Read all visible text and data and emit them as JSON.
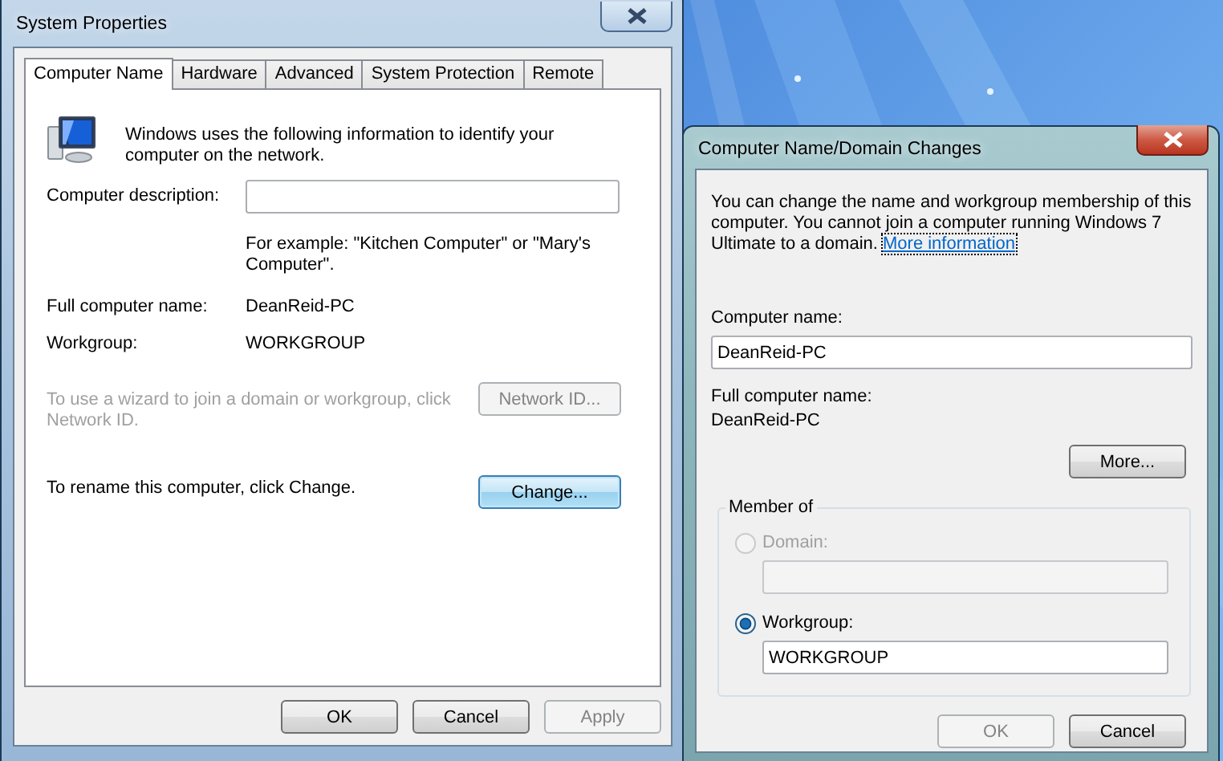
{
  "system_properties": {
    "title": "System Properties",
    "active": false,
    "tabs": [
      {
        "label": "Computer Name",
        "selected": true
      },
      {
        "label": "Hardware",
        "selected": false
      },
      {
        "label": "Advanced",
        "selected": false
      },
      {
        "label": "System Protection",
        "selected": false
      },
      {
        "label": "Remote",
        "selected": false
      }
    ],
    "intro": "Windows uses the following information to identify your computer on the network.",
    "description": {
      "label": "Computer description:",
      "hint": "For example: \"Kitchen Computer\" or \"Mary's Computer\"."
    },
    "info_rows": [
      {
        "label": "Full computer name:",
        "value": "DeanReid-PC"
      },
      {
        "label": "Workgroup:",
        "value": "WORKGROUP"
      }
    ],
    "actions": [
      {
        "text": "To use a wizard to join a domain or workgroup, click Network ID.",
        "button": "Network ID...",
        "disabled": true,
        "focused": false
      },
      {
        "text": "To rename this computer, click Change.",
        "button": "Change...",
        "disabled": false,
        "focused": true
      }
    ],
    "buttons": [
      {
        "label": "OK",
        "disabled": false
      },
      {
        "label": "Cancel",
        "disabled": false
      },
      {
        "label": "Apply",
        "disabled": true
      }
    ]
  },
  "domain_changes": {
    "title": "Computer Name/Domain Changes",
    "active": true,
    "intro": "You can change the name and workgroup membership of this computer. You cannot join a computer running Windows 7 Ultimate to a domain.",
    "link": "More information",
    "computer_name": {
      "label": "Computer name:",
      "value": "DeanReid-PC"
    },
    "full_name": {
      "label": "Full computer name:",
      "value": "DeanReid-PC"
    },
    "more_button": "More...",
    "member_of": {
      "legend": "Member of",
      "options": [
        {
          "label": "Domain:",
          "selected": false,
          "disabled": true
        },
        {
          "label": "Workgroup:",
          "selected": true,
          "disabled": false,
          "value": "WORKGROUP"
        }
      ]
    },
    "buttons": [
      {
        "label": "OK",
        "disabled": true
      },
      {
        "label": "Cancel",
        "disabled": false
      }
    ]
  }
}
